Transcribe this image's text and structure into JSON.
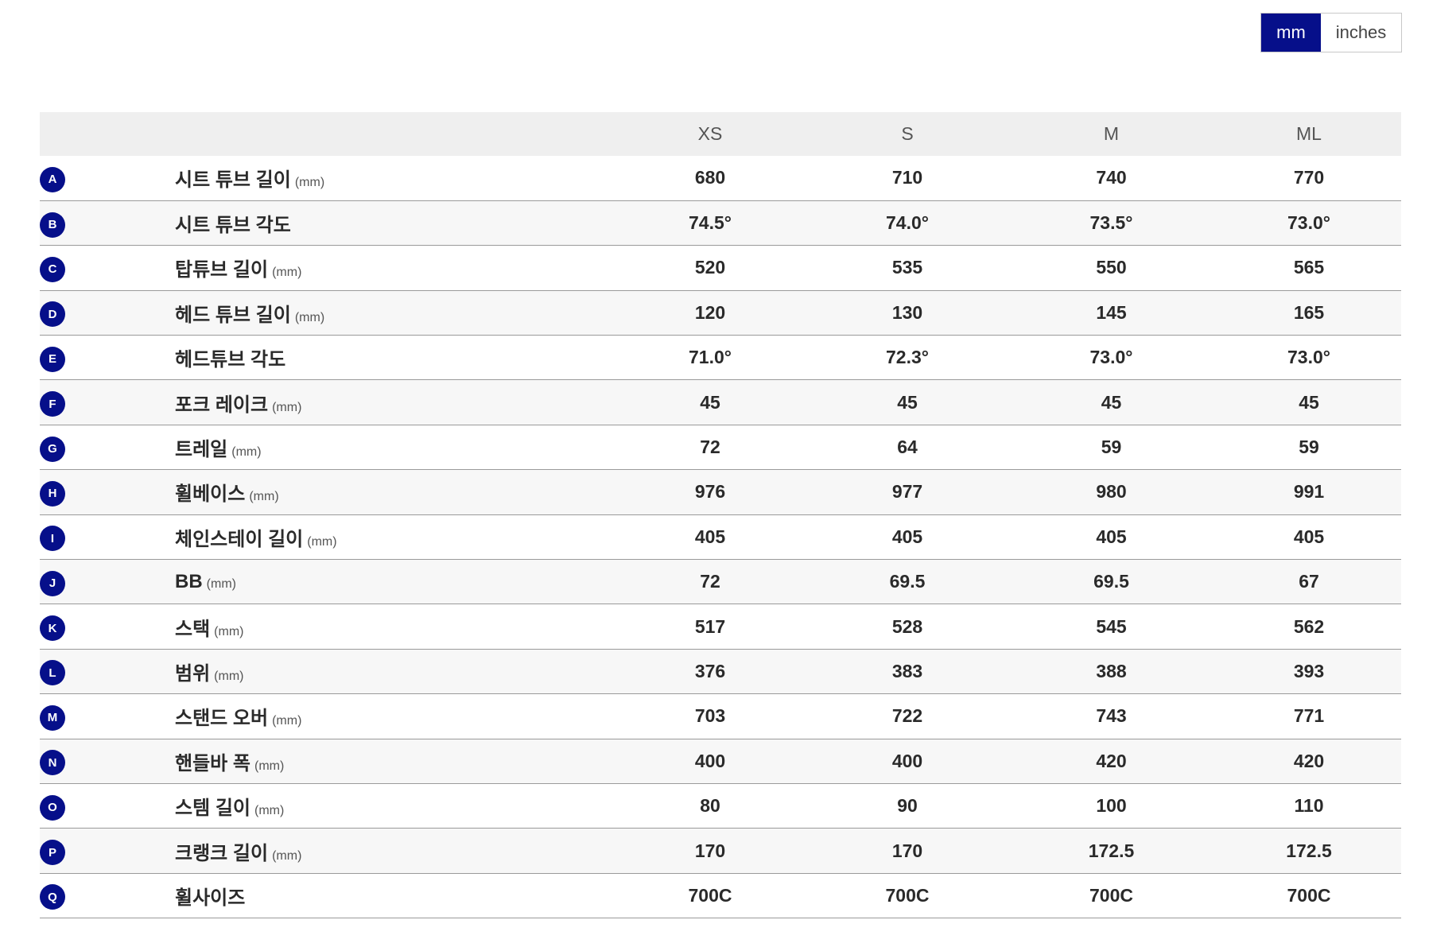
{
  "units": {
    "mm_label": "mm",
    "inches_label": "inches",
    "active": "mm"
  },
  "columns": [
    "XS",
    "S",
    "M",
    "ML"
  ],
  "rows": [
    {
      "key": "A",
      "label": "시트 튜브 길이",
      "unit": "(mm)",
      "values": [
        "680",
        "710",
        "740",
        "770"
      ]
    },
    {
      "key": "B",
      "label": "시트 튜브 각도",
      "unit": "",
      "values": [
        "74.5°",
        "74.0°",
        "73.5°",
        "73.0°"
      ]
    },
    {
      "key": "C",
      "label": "탑튜브 길이",
      "unit": "(mm)",
      "values": [
        "520",
        "535",
        "550",
        "565"
      ]
    },
    {
      "key": "D",
      "label": "헤드 튜브 길이",
      "unit": "(mm)",
      "values": [
        "120",
        "130",
        "145",
        "165"
      ]
    },
    {
      "key": "E",
      "label": "헤드튜브 각도",
      "unit": "",
      "values": [
        "71.0°",
        "72.3°",
        "73.0°",
        "73.0°"
      ]
    },
    {
      "key": "F",
      "label": "포크 레이크",
      "unit": "(mm)",
      "values": [
        "45",
        "45",
        "45",
        "45"
      ]
    },
    {
      "key": "G",
      "label": "트레일",
      "unit": "(mm)",
      "values": [
        "72",
        "64",
        "59",
        "59"
      ]
    },
    {
      "key": "H",
      "label": "휠베이스",
      "unit": "(mm)",
      "values": [
        "976",
        "977",
        "980",
        "991"
      ]
    },
    {
      "key": "I",
      "label": "체인스테이 길이",
      "unit": "(mm)",
      "values": [
        "405",
        "405",
        "405",
        "405"
      ]
    },
    {
      "key": "J",
      "label": "BB",
      "unit": "(mm)",
      "values": [
        "72",
        "69.5",
        "69.5",
        "67"
      ]
    },
    {
      "key": "K",
      "label": "스택",
      "unit": "(mm)",
      "values": [
        "517",
        "528",
        "545",
        "562"
      ]
    },
    {
      "key": "L",
      "label": "범위",
      "unit": "(mm)",
      "values": [
        "376",
        "383",
        "388",
        "393"
      ]
    },
    {
      "key": "M",
      "label": "스탠드 오버",
      "unit": "(mm)",
      "values": [
        "703",
        "722",
        "743",
        "771"
      ]
    },
    {
      "key": "N",
      "label": "핸들바 폭",
      "unit": "(mm)",
      "values": [
        "400",
        "400",
        "420",
        "420"
      ]
    },
    {
      "key": "O",
      "label": "스템 길이",
      "unit": "(mm)",
      "values": [
        "80",
        "90",
        "100",
        "110"
      ]
    },
    {
      "key": "P",
      "label": "크랭크 길이",
      "unit": "(mm)",
      "values": [
        "170",
        "170",
        "172.5",
        "172.5"
      ]
    },
    {
      "key": "Q",
      "label": "휠사이즈",
      "unit": "",
      "values": [
        "700C",
        "700C",
        "700C",
        "700C"
      ]
    }
  ],
  "colors": {
    "accent": "#060f8a",
    "header_bg": "#efefef",
    "row_alt_bg": "#f7f7f7"
  }
}
